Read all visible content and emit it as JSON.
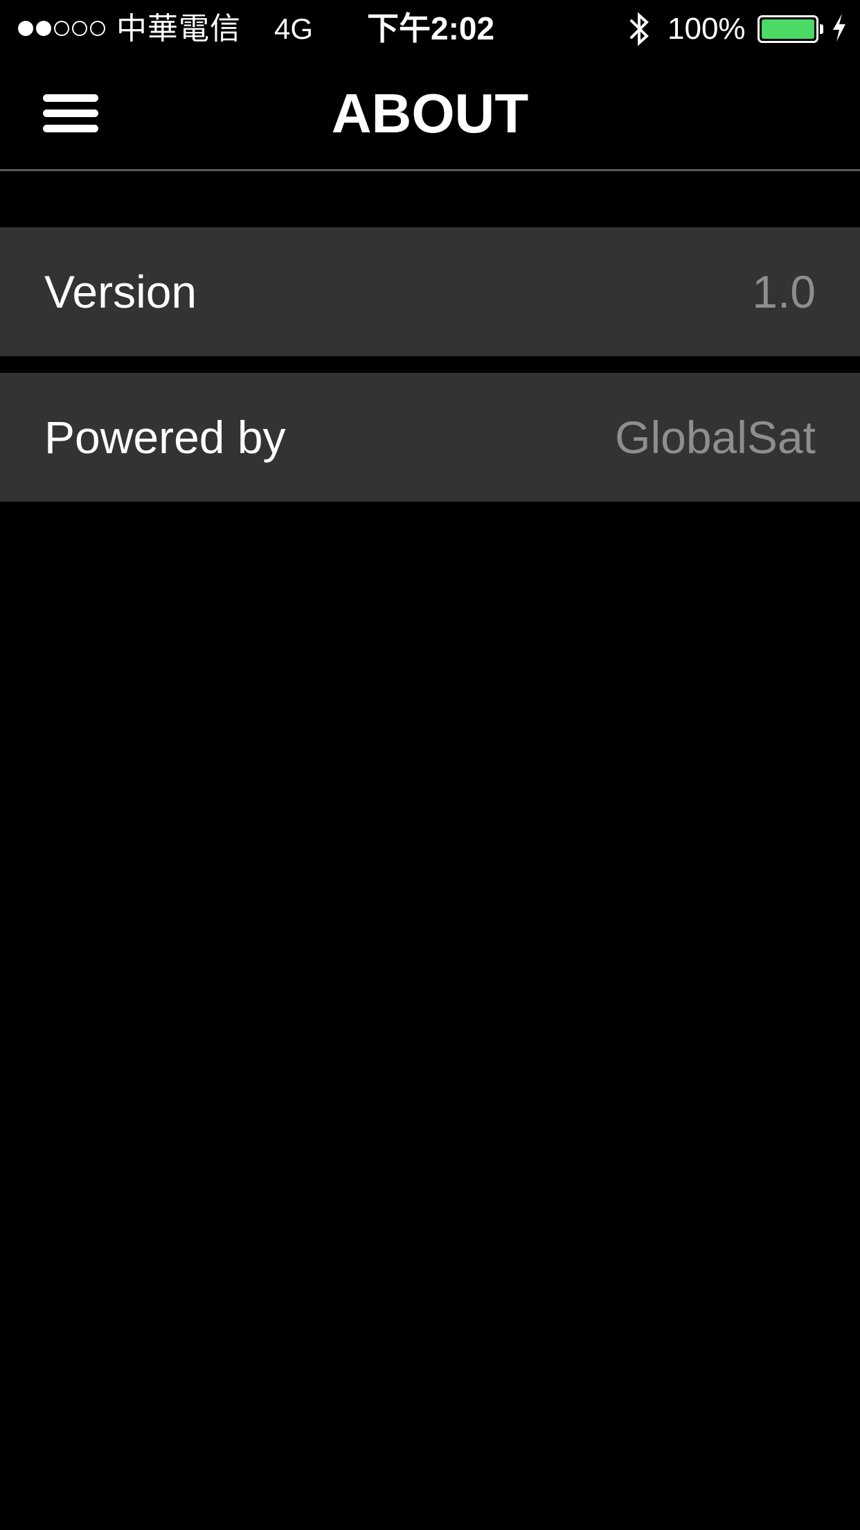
{
  "status_bar": {
    "signal_strength": "2 of 5",
    "carrier": "中華電信",
    "network": "4G",
    "time": "下午2:02",
    "bluetooth_icon": "bluetooth-icon",
    "battery_percent": "100%",
    "battery_level": 1.0,
    "battery_color": "#4cd964",
    "charging_icon": "charging-bolt-icon"
  },
  "nav": {
    "menu_icon": "hamburger-menu-icon",
    "title": "ABOUT"
  },
  "about": {
    "rows": [
      {
        "label": "Version",
        "value": "1.0"
      },
      {
        "label": "Powered by",
        "value": "GlobalSat"
      }
    ]
  },
  "colors": {
    "background": "#000000",
    "row_background": "#333333",
    "label_text": "#ffffff",
    "value_text": "#8e8e8e"
  }
}
